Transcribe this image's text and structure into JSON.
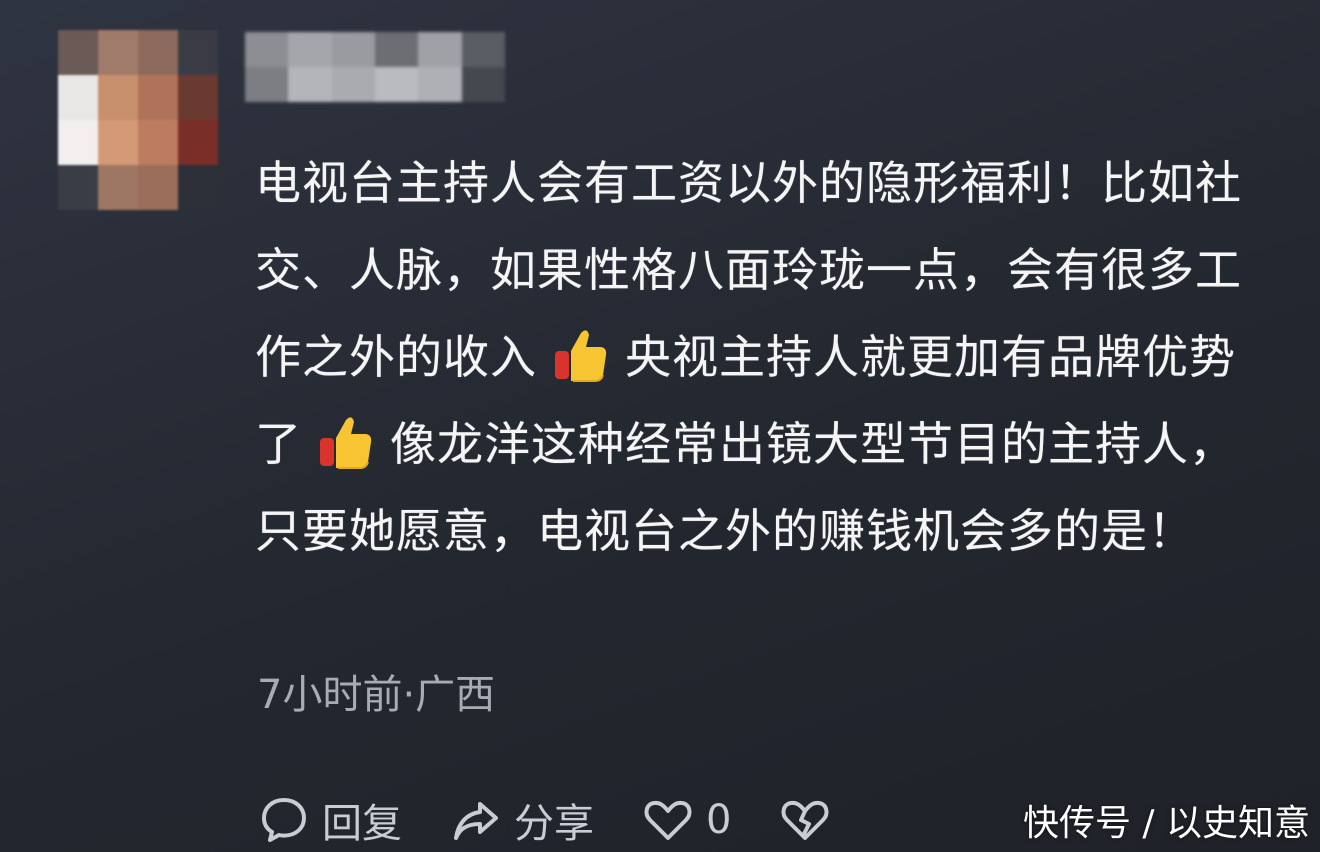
{
  "comment": {
    "avatar_icon": "blurred-avatar",
    "username_icon": "blurred-username",
    "text_part1": "电视台主持人会有工资以外的隐形福利！比如社交、人脉，如果性格八面玲珑一点，会有很多工作之外的收入",
    "text_part2": "央视主持人就更加有品牌优势了",
    "text_part3": "像龙洋这种经常出镜大型节目的主持人，只要她愿意，电视台之外的赚钱机会多的是！",
    "emoji_icon": "thumbs-up-emoji",
    "meta": "7小时前·广西"
  },
  "actions": {
    "reply_icon": "comment-bubble-icon",
    "reply_label": "回复",
    "share_icon": "share-arrow-icon",
    "share_label": "分享",
    "like_icon": "heart-icon",
    "like_count": "0",
    "dislike_icon": "broken-heart-icon"
  },
  "watermark": "快传号 / 以史知意",
  "colors": {
    "background": "#2a2e37",
    "text": "#f5f5f5",
    "meta_text": "#a8abb2",
    "icon": "#c9ccd2",
    "emoji_yellow": "#f7c531",
    "emoji_red": "#d9342b"
  }
}
